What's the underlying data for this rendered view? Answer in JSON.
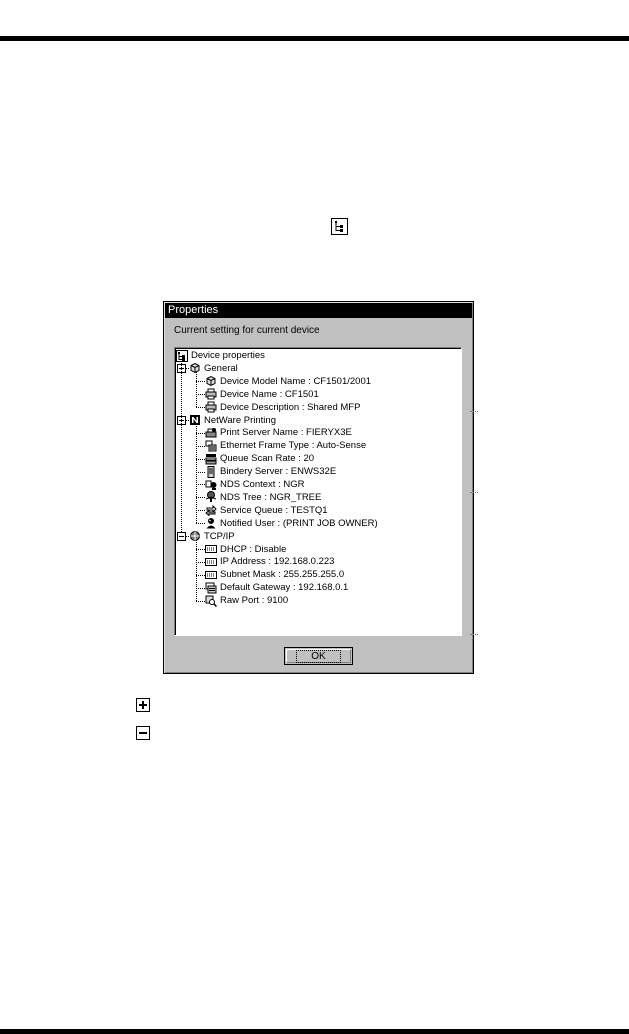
{
  "dialog": {
    "title": "Properties",
    "caption": "Current setting for current device",
    "ok_label": "OK"
  },
  "tree": {
    "root": "Device properties",
    "groups": [
      {
        "label": "General",
        "icon": "cube-icon",
        "items": [
          {
            "label": "Device Model Name : CF1501/2001",
            "icon": "cube-icon"
          },
          {
            "label": "Device Name : CF1501",
            "icon": "printer-icon"
          },
          {
            "label": "Device Description : Shared MFP",
            "icon": "printer-icon"
          }
        ]
      },
      {
        "label": "NetWare Printing",
        "icon": "netware-icon",
        "items": [
          {
            "label": "Print Server Name : FIERYX3E",
            "icon": "print-server-icon"
          },
          {
            "label": "Ethernet Frame Type : Auto-Sense",
            "icon": "network-frame-icon"
          },
          {
            "label": "Queue Scan Rate : 20",
            "icon": "queue-icon"
          },
          {
            "label": "Bindery Server : ENWS32E",
            "icon": "server-tower-icon"
          },
          {
            "label": "NDS Context : NGR",
            "icon": "nds-context-icon"
          },
          {
            "label": "NDS Tree : NGR_TREE",
            "icon": "nds-tree-icon"
          },
          {
            "label": "Service Queue : TESTQ1",
            "icon": "service-queue-icon"
          },
          {
            "label": "Notified User : (PRINT JOB OWNER)",
            "icon": "user-icon"
          }
        ]
      },
      {
        "label": "TCP/IP",
        "icon": "tcpip-icon",
        "items": [
          {
            "label": "DHCP : Disable",
            "icon": "ip-field-icon"
          },
          {
            "label": "IP Address : 192.168.0.223",
            "icon": "ip-field-icon"
          },
          {
            "label": "Subnet Mask : 255.255.255.0",
            "icon": "ip-field-icon"
          },
          {
            "label": "Default Gateway : 192.168.0.1",
            "icon": "gateway-icon"
          },
          {
            "label": "Raw Port : 9100",
            "icon": "magnifier-icon"
          }
        ]
      }
    ]
  },
  "doc_icons": {
    "properties": "device-properties-icon",
    "expand": "plus-box-icon",
    "collapse": "minus-box-icon"
  }
}
